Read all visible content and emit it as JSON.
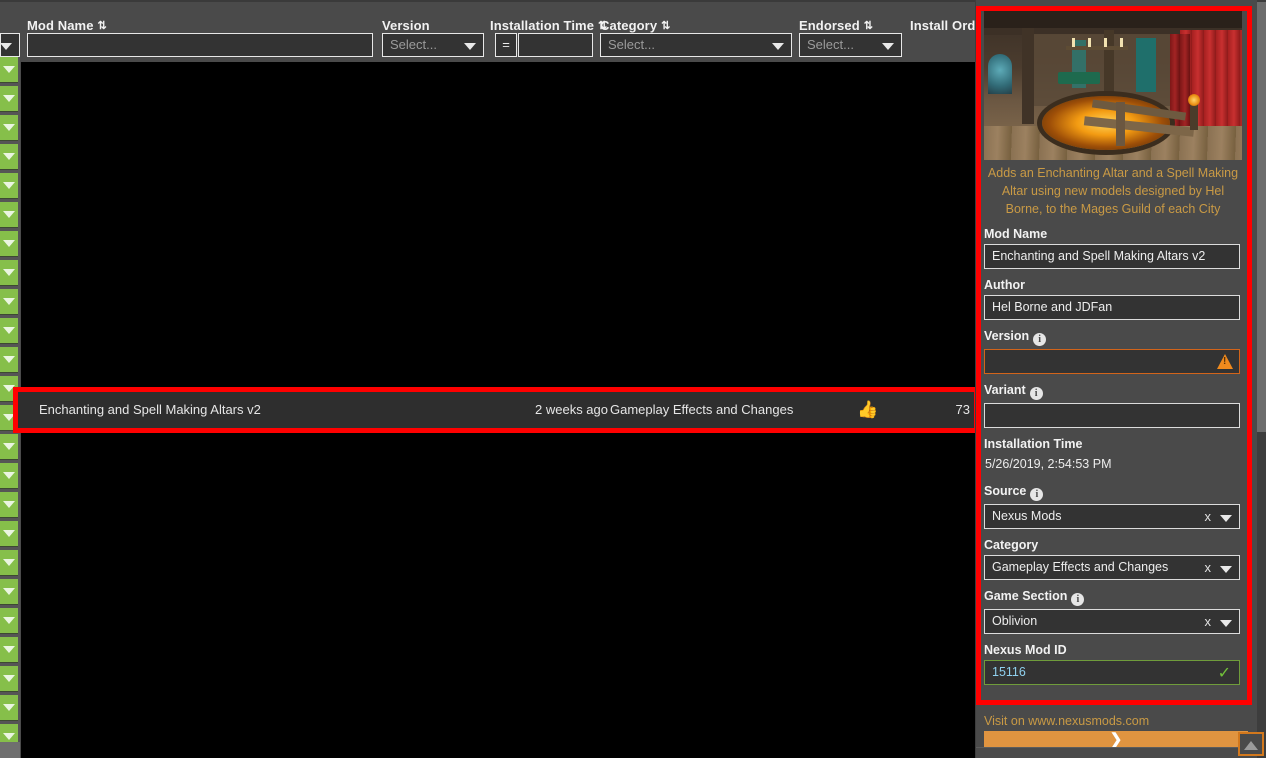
{
  "colors": {
    "highlight": "#ff0000",
    "accent_orange": "#e09440",
    "link_orange": "#c99a45",
    "green_gutter": "#86bf4a",
    "valid_green": "#72c13a",
    "warn_orange": "#f08a1d",
    "panel_bg": "#4a4a4a",
    "grid_bg": "#000000",
    "row_bg": "#2e2e2e"
  },
  "table": {
    "columns": [
      {
        "title": "Mod Name",
        "sortable": true,
        "sort_icon": "sort-icon"
      },
      {
        "title": "Version",
        "sortable": false,
        "sort_icon": ""
      },
      {
        "title": "Installation Time",
        "sortable": true,
        "sort_icon": "sort-icon"
      },
      {
        "title": "Category",
        "sortable": true,
        "sort_icon": "sort-icon"
      },
      {
        "title": "Endorsed",
        "sortable": true,
        "sort_icon": "sort-icon"
      },
      {
        "title": "Install Order",
        "sortable": false,
        "sort_icon": ""
      }
    ],
    "filters": {
      "mod_name_value": "",
      "mod_name_placeholder": "",
      "version_placeholder": "Select...",
      "install_time_operator": "=",
      "install_time_value": "",
      "category_placeholder": "Select...",
      "endorsed_placeholder": "Select..."
    },
    "selected_row": {
      "mod_name": "Enchanting and Spell Making Altars v2",
      "version": "",
      "installation_time": "2 weeks ago",
      "category": "Gameplay Effects and Changes",
      "endorsed_icon": "thumbs-up-icon",
      "install_order": "73"
    },
    "gutter_rows": 24,
    "gutter_icon": "chevron-down-icon"
  },
  "details": {
    "thumbnail_alt": "mod-preview-image",
    "description": "Adds an Enchanting Altar and a Spell Making Altar using new models designed by Hel Borne, to the Mages Guild of each City",
    "fields": [
      {
        "key": "mod_name",
        "label": "Mod Name",
        "value": "Enchanting and Spell Making Altars v2",
        "type": "text",
        "info": false,
        "state": "normal"
      },
      {
        "key": "author",
        "label": "Author",
        "value": "Hel Borne and JDFan",
        "type": "text",
        "info": false,
        "state": "normal"
      },
      {
        "key": "version",
        "label": "Version",
        "value": "",
        "type": "text",
        "info": true,
        "state": "warning"
      },
      {
        "key": "variant",
        "label": "Variant",
        "value": "",
        "type": "text",
        "info": true,
        "state": "normal"
      },
      {
        "key": "install_time",
        "label": "Installation Time",
        "value": "5/26/2019, 2:54:53 PM",
        "type": "static",
        "info": false,
        "state": "normal"
      },
      {
        "key": "source",
        "label": "Source",
        "value": "Nexus Mods",
        "type": "select",
        "info": true,
        "state": "normal"
      },
      {
        "key": "category",
        "label": "Category",
        "value": "Gameplay Effects and Changes",
        "type": "select",
        "info": false,
        "state": "normal"
      },
      {
        "key": "game_section",
        "label": "Game Section",
        "value": "Oblivion",
        "type": "select",
        "info": true,
        "state": "normal"
      },
      {
        "key": "nexus_mod_id",
        "label": "Nexus Mod ID",
        "value": "15116",
        "type": "text",
        "info": false,
        "state": "valid"
      }
    ],
    "visit_link": "Visit on www.nexusmods.com",
    "expand_icon": "chevron-right-icon",
    "clear_icon": "x",
    "info_glyph": "i"
  },
  "widgets": {
    "scroll_top_icon": "arrow-up-icon"
  }
}
